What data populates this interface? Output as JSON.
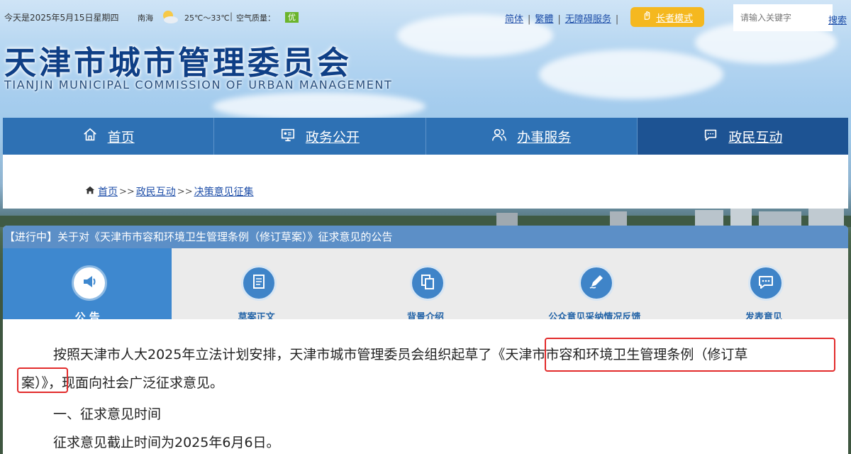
{
  "topbar": {
    "date": "今天是2025年5月15日星期四",
    "city": "南海",
    "weather_icon": "sun-cloud-icon",
    "temperature": "25℃～33℃",
    "aqi_label": "空气质量：",
    "aqi_value": "优",
    "aqi_color": "#6bb42c",
    "links": [
      {
        "label": "简体"
      },
      {
        "label": "繁體"
      },
      {
        "label": "无障碍服务"
      }
    ],
    "elder_mode": "长者模式",
    "search_placeholder": "请输入关键字",
    "search_button": "搜索"
  },
  "site": {
    "title": "天津市城市管理委员会",
    "subtitle": "TIANJIN MUNICIPAL COMMISSION OF URBAN MANAGEMENT"
  },
  "nav": [
    {
      "label": "首页",
      "icon": "home-icon"
    },
    {
      "label": "政务公开",
      "icon": "monitor-icon"
    },
    {
      "label": "办事服务",
      "icon": "users-icon"
    },
    {
      "label": "政民互动",
      "icon": "chat-icon"
    }
  ],
  "breadcrumb": {
    "icon": "home-icon",
    "items": [
      "首页",
      "政民互动",
      "决策意见征集"
    ],
    "separator": ">>"
  },
  "notice": {
    "title": "【进行中】关于对《天津市市容和环境卫生管理条例（修订草案）》征求意见的公告",
    "steps": [
      {
        "label": "公 告",
        "icon": "megaphone-icon",
        "active": true
      },
      {
        "label": "草案正文",
        "icon": "document-icon",
        "active": false
      },
      {
        "label": "背景介绍",
        "icon": "copy-icon",
        "active": false
      },
      {
        "label": "公众意见采纳情况反馈",
        "icon": "pen-icon",
        "active": false
      },
      {
        "label": "发表意见",
        "icon": "comment-icon",
        "active": false
      }
    ],
    "paragraph1_line1": "按照天津市人大2025年立法计划安排，天津市城市管理委员会组织起草了《天津市市容和环境卫生管理条例（修订草",
    "paragraph1_line2": "案）》，现面向社会广泛征求意见。",
    "section1_heading": "一、征求意见时间",
    "section1_text": "征求意见截止时间为2025年6月6日。"
  },
  "colors": {
    "nav_blue": "#2e71b4",
    "nav_active": "#1d5393",
    "header_blue": "#5c8fc7",
    "step_active": "#3e88cf",
    "highlight_red": "#e22b2b",
    "elder_btn": "#f5b81f",
    "title_blue": "#0f3f86"
  }
}
